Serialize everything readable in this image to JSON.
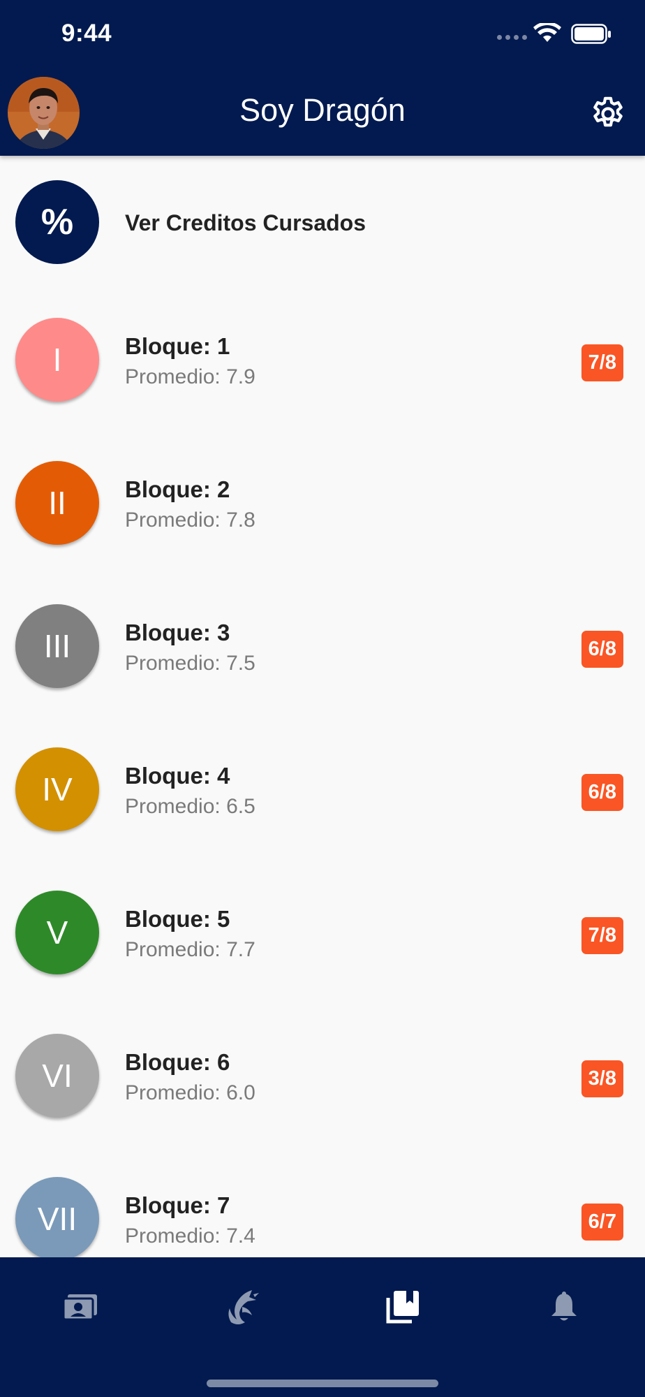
{
  "status_bar": {
    "time": "9:44"
  },
  "header": {
    "title": "Soy Dragón",
    "settings_icon": "gear-icon"
  },
  "credits": {
    "symbol": "%",
    "label": "Ver Creditos Cursados",
    "color": "#021a4f"
  },
  "blocks": [
    {
      "numeral": "I",
      "title": "Bloque: 1",
      "average": "Promedio: 7.9",
      "badge": "7/8",
      "color": "#ff8a8a"
    },
    {
      "numeral": "II",
      "title": "Bloque: 2",
      "average": "Promedio: 7.8",
      "badge": "",
      "color": "#e35c05"
    },
    {
      "numeral": "III",
      "title": "Bloque: 3",
      "average": "Promedio: 7.5",
      "badge": "6/8",
      "color": "#808080"
    },
    {
      "numeral": "IV",
      "title": "Bloque: 4",
      "average": "Promedio: 6.5",
      "badge": "6/8",
      "color": "#d39000"
    },
    {
      "numeral": "V",
      "title": "Bloque: 5",
      "average": "Promedio: 7.7",
      "badge": "7/8",
      "color": "#2e8a29"
    },
    {
      "numeral": "VI",
      "title": "Bloque: 6",
      "average": "Promedio: 6.0",
      "badge": "3/8",
      "color": "#a8a8a8"
    },
    {
      "numeral": "VII",
      "title": "Bloque: 7",
      "average": "Promedio: 7.4",
      "badge": "6/7",
      "color": "#7b9ab9"
    }
  ],
  "badge_color": "#fa5524",
  "bottom_nav": [
    {
      "icon": "id-card-icon",
      "active": false
    },
    {
      "icon": "dragon-icon",
      "active": false
    },
    {
      "icon": "bookmarks-icon",
      "active": true
    },
    {
      "icon": "bell-icon",
      "active": false
    }
  ],
  "colors": {
    "primary": "#021a4f",
    "background": "#f9f9f9"
  }
}
